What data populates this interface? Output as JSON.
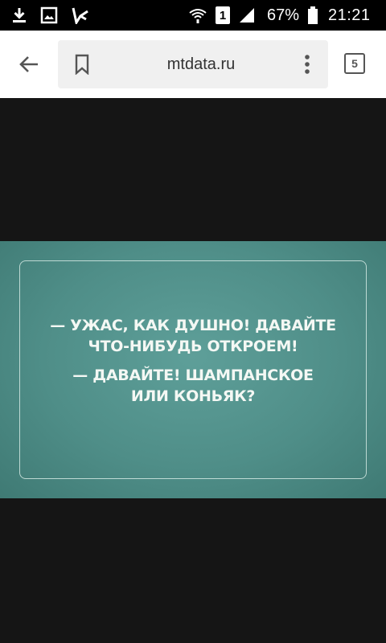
{
  "status_bar": {
    "battery_percent": "67%",
    "time": "21:21",
    "sim_slot": "1"
  },
  "toolbar": {
    "url": "mtdata.ru",
    "tab_count": "5"
  },
  "image": {
    "line1": "— УЖАС, КАК ДУШНО! ДАВАЙТЕ",
    "line2": "ЧТО-НИБУДЬ ОТКРОЕМ!",
    "line3": "— ДАВАЙТЕ! ШАМПАНСКОЕ",
    "line4": "ИЛИ КОНЬЯК?"
  }
}
